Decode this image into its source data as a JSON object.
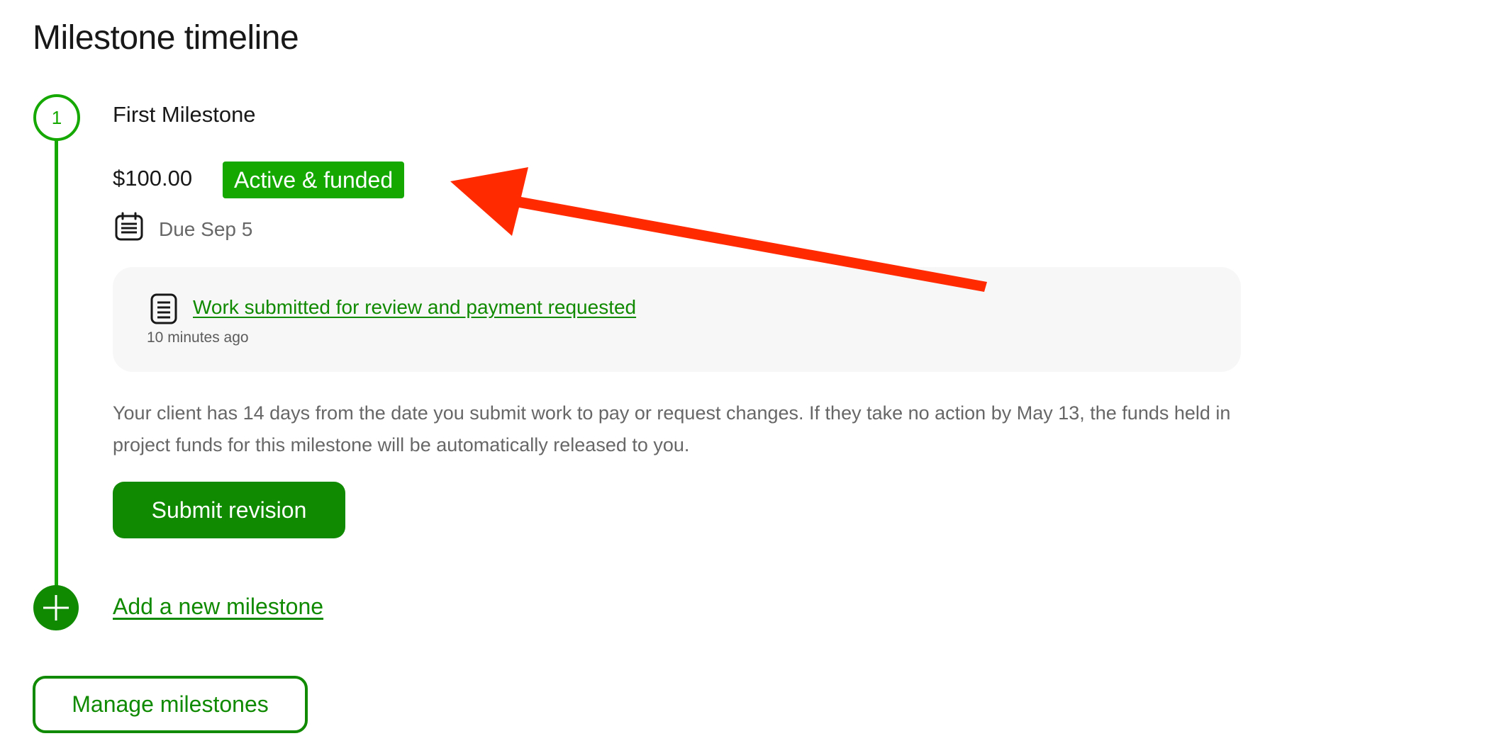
{
  "page": {
    "title": "Milestone timeline"
  },
  "milestone": {
    "step_number": "1",
    "name": "First Milestone",
    "amount": "$100.00",
    "status_badge": "Active & funded",
    "due_date": "Due Sep 5",
    "activity": {
      "link_text": "Work submitted for review and payment requested",
      "time": "10 minutes ago"
    },
    "info_text": "Your client has 14 days from the date you submit work to pay or request changes. If they take no action by May 13, the funds held in project funds for this milestone will be automatically released to you.",
    "submit_revision_label": "Submit revision"
  },
  "timeline": {
    "add_milestone_label": "Add a new milestone"
  },
  "actions": {
    "manage_milestones_label": "Manage milestones"
  },
  "icons": {
    "due": "calendar-icon",
    "activity": "document-icon",
    "add": "plus-icon"
  },
  "colors": {
    "brand_green": "#108a00",
    "badge_green": "#14a800",
    "annotation_arrow": "#ff2a00",
    "card_bg": "#f7f7f7"
  }
}
